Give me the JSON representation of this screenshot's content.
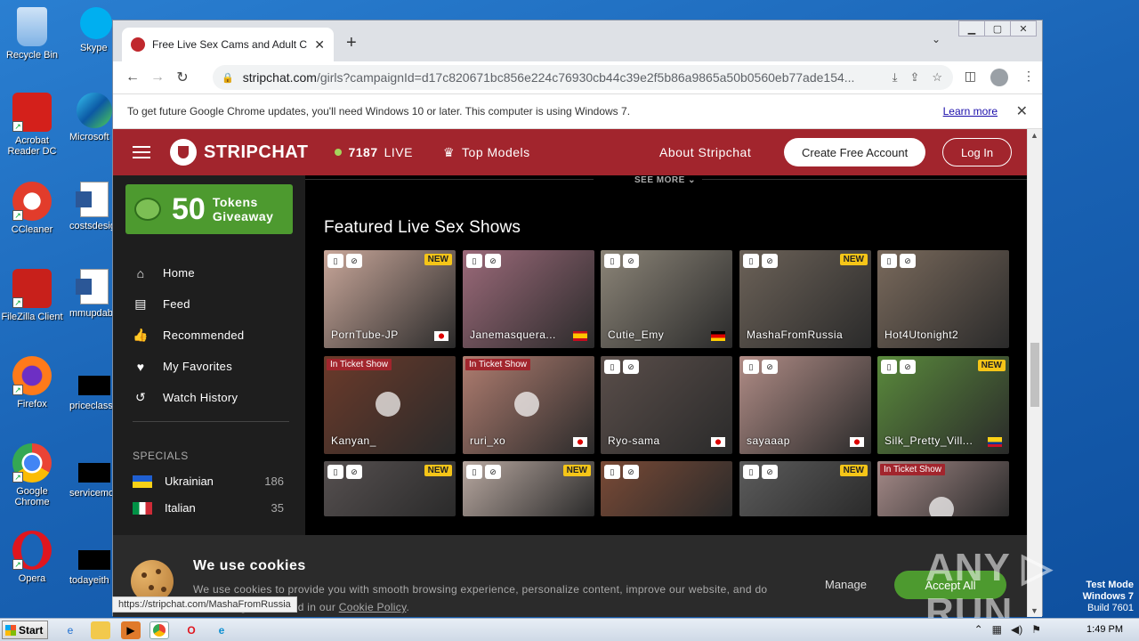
{
  "desktop": {
    "icons_left": [
      {
        "label": "Recycle Bin",
        "icon": "recycle-bin-icon",
        "color": "#7fb2e5"
      },
      {
        "label": "Acrobat Reader DC",
        "icon": "acrobat-icon",
        "color": "#d4201b"
      },
      {
        "label": "CCleaner",
        "icon": "ccleaner-icon",
        "color": "#e23c2b"
      },
      {
        "label": "FileZilla Client",
        "icon": "filezilla-icon",
        "color": "#c8201b"
      },
      {
        "label": "Firefox",
        "icon": "firefox-icon",
        "color": "#ff7a1a"
      },
      {
        "label": "Google Chrome",
        "icon": "chrome-icon",
        "color": "#4285f4"
      },
      {
        "label": "Opera",
        "icon": "opera-icon",
        "color": "#e0161f"
      }
    ],
    "icons_right": [
      {
        "label": "Skype",
        "icon": "skype-icon"
      },
      {
        "label": "Microsoft",
        "icon": "edge-icon"
      },
      {
        "label": "costsdesig",
        "icon": "word-doc-icon"
      },
      {
        "label": "mmupdab",
        "icon": "word-doc-icon"
      },
      {
        "label": "priceclass",
        "icon": "black-file-icon"
      },
      {
        "label": "servicemc",
        "icon": "black-file-icon"
      },
      {
        "label": "todayeith",
        "icon": "black-file-icon"
      }
    ]
  },
  "browser": {
    "tab_title": "Free Live Sex Cams and Adult Chat",
    "url_host": "stripchat.com",
    "url_rest": "/girls?campaignId=d17c820671bc856e224c76930cb44c39e2f5b86a9865a50b0560eb77ade154...",
    "infobar_text": "To get future Google Chrome updates, you'll need Windows 10 or later. This computer is using Windows 7.",
    "infobar_link": "Learn more",
    "status_url": "https://stripchat.com/MashaFromRussia"
  },
  "site": {
    "brand": "STRIPCHAT",
    "live_count": "7187",
    "live_label": "LIVE",
    "top_models": "Top Models",
    "about": "About Stripchat",
    "create_account": "Create Free Account",
    "login": "Log In",
    "giveaway_num": "50",
    "giveaway_line1": "Tokens",
    "giveaway_line2": "Giveaway",
    "nav": [
      {
        "label": "Home",
        "icon": "home-icon",
        "glyph": "⌂"
      },
      {
        "label": "Feed",
        "icon": "feed-icon",
        "glyph": "▤"
      },
      {
        "label": "Recommended",
        "icon": "thumbs-up-icon",
        "glyph": "👍"
      },
      {
        "label": "My Favorites",
        "icon": "heart-icon",
        "glyph": "♥"
      },
      {
        "label": "Watch History",
        "icon": "history-icon",
        "glyph": "↺"
      }
    ],
    "specials_label": "SPECIALS",
    "countries": [
      {
        "name": "Ukrainian",
        "count": "186"
      },
      {
        "name": "Italian",
        "count": "35"
      }
    ],
    "see_more": "SEE MORE",
    "featured_title": "Featured Live Sex Shows",
    "new_label": "NEW",
    "ticket_label": "In Ticket Show",
    "cards": [
      {
        "name": "PornTube-JP",
        "new": true,
        "ticket": false,
        "flag": "jp",
        "color": "#c9a79a"
      },
      {
        "name": "Janemasquera...",
        "new": false,
        "ticket": false,
        "flag": "es",
        "color": "#9c6a7a"
      },
      {
        "name": "Cutie_Emy",
        "new": false,
        "ticket": false,
        "flag": "de",
        "color": "#8c8578"
      },
      {
        "name": "MashaFromRussia",
        "new": true,
        "ticket": false,
        "flag": "",
        "color": "#6c6258"
      },
      {
        "name": "Hot4Utonight2",
        "new": false,
        "ticket": false,
        "flag": "",
        "color": "#7a6a5c"
      },
      {
        "name": "Kanyan_",
        "new": false,
        "ticket": true,
        "flag": "",
        "color": "#6b3a2a"
      },
      {
        "name": "ruri_xo",
        "new": false,
        "ticket": true,
        "flag": "jp",
        "color": "#b07d70"
      },
      {
        "name": "Ryo-sama",
        "new": false,
        "ticket": false,
        "flag": "jp",
        "color": "#5a4e4a"
      },
      {
        "name": "sayaaap",
        "new": false,
        "ticket": false,
        "flag": "jp",
        "color": "#b08c86"
      },
      {
        "name": "Silk_Pretty_Vill...",
        "new": true,
        "ticket": false,
        "flag": "co",
        "color": "#5a8a3c"
      },
      {
        "name": "",
        "new": true,
        "ticket": false,
        "flag": "",
        "color": "#565050"
      },
      {
        "name": "",
        "new": true,
        "ticket": false,
        "flag": "",
        "color": "#b8a8a0"
      },
      {
        "name": "",
        "new": false,
        "ticket": false,
        "flag": "",
        "color": "#7a4a36"
      },
      {
        "name": "",
        "new": true,
        "ticket": false,
        "flag": "",
        "color": "#5c5c5c"
      },
      {
        "name": "",
        "new": false,
        "ticket": true,
        "flag": "",
        "color": "#a58a88"
      }
    ],
    "cookie_title": "We use cookies",
    "cookie_text": "We use cookies to provide you with smooth browsing experience, personalize content, improve our website, and do other things described in our",
    "cookie_link": "Cookie Policy",
    "cookie_manage": "Manage",
    "cookie_accept": "Accept All"
  },
  "taskbar": {
    "start": "Start",
    "time": "1:49 PM"
  },
  "watermark": {
    "line1": "Test Mode",
    "line2": "Windows 7",
    "line3": "Build 7601",
    "brand": "ANY RUN"
  }
}
